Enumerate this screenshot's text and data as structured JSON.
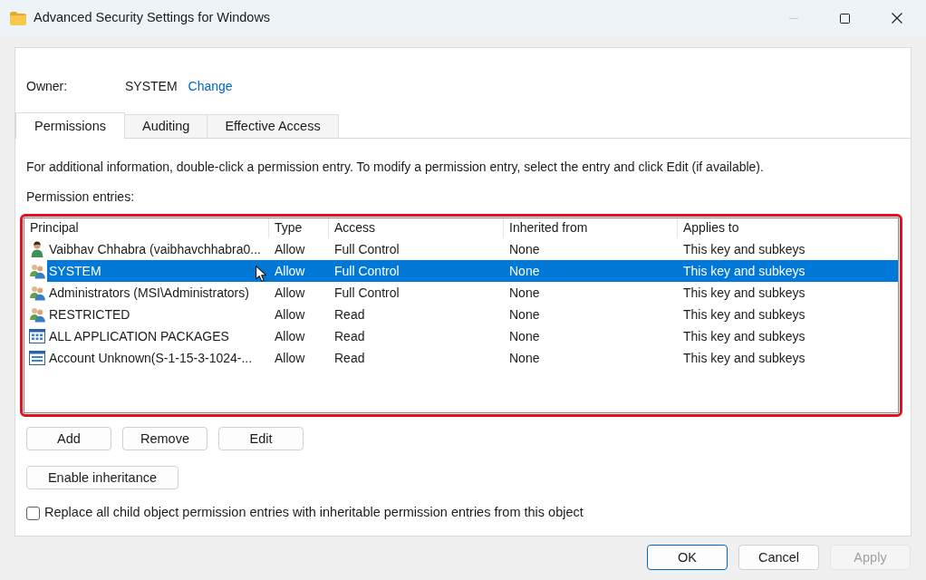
{
  "window": {
    "title": "Advanced Security Settings for Windows",
    "minimize_disabled": true
  },
  "owner": {
    "label": "Owner:",
    "value": "SYSTEM",
    "link": "Change"
  },
  "tabs": [
    {
      "label": "Permissions",
      "selected": true
    },
    {
      "label": "Auditing",
      "selected": false
    },
    {
      "label": "Effective Access",
      "selected": false
    }
  ],
  "info_text": "For additional information, double-click a permission entry. To modify a permission entry, select the entry and click Edit (if available).",
  "entries_label": "Permission entries:",
  "permission_table": {
    "highlighted": true,
    "columns": [
      "Principal",
      "Type",
      "Access",
      "Inherited from",
      "Applies to"
    ],
    "rows": [
      {
        "kind": "user",
        "principal": "Vaibhav Chhabra (vaibhavchhabra0...",
        "type": "Allow",
        "access": "Full Control",
        "inherited_from": "None",
        "applies_to": "This key and subkeys",
        "selected": false,
        "pointer": false
      },
      {
        "kind": "group",
        "principal": "SYSTEM",
        "type": "Allow",
        "access": "Full Control",
        "inherited_from": "None",
        "applies_to": "This key and subkeys",
        "selected": true,
        "pointer": true
      },
      {
        "kind": "group",
        "principal": "Administrators (MSI\\Administrators)",
        "type": "Allow",
        "access": "Full Control",
        "inherited_from": "None",
        "applies_to": "This key and subkeys",
        "selected": false,
        "pointer": false
      },
      {
        "kind": "group",
        "principal": "RESTRICTED",
        "type": "Allow",
        "access": "Read",
        "inherited_from": "None",
        "applies_to": "This key and subkeys",
        "selected": false,
        "pointer": false
      },
      {
        "kind": "package",
        "principal": "ALL APPLICATION PACKAGES",
        "type": "Allow",
        "access": "Read",
        "inherited_from": "None",
        "applies_to": "This key and subkeys",
        "selected": false,
        "pointer": false
      },
      {
        "kind": "account",
        "principal": "Account Unknown(S-1-15-3-1024-...",
        "type": "Allow",
        "access": "Read",
        "inherited_from": "None",
        "applies_to": "This key and subkeys",
        "selected": false,
        "pointer": false
      }
    ]
  },
  "action_buttons": [
    "Add",
    "Remove",
    "Edit"
  ],
  "inheritance_button": "Enable inheritance",
  "replace_checkbox": {
    "label": "Replace all child object permission entries with inheritable permission entries from this object",
    "checked": false
  },
  "dialog_buttons": [
    {
      "label": "OK",
      "default": true,
      "disabled": false
    },
    {
      "label": "Cancel",
      "default": false,
      "disabled": false
    },
    {
      "label": "Apply",
      "default": false,
      "disabled": true
    }
  ]
}
